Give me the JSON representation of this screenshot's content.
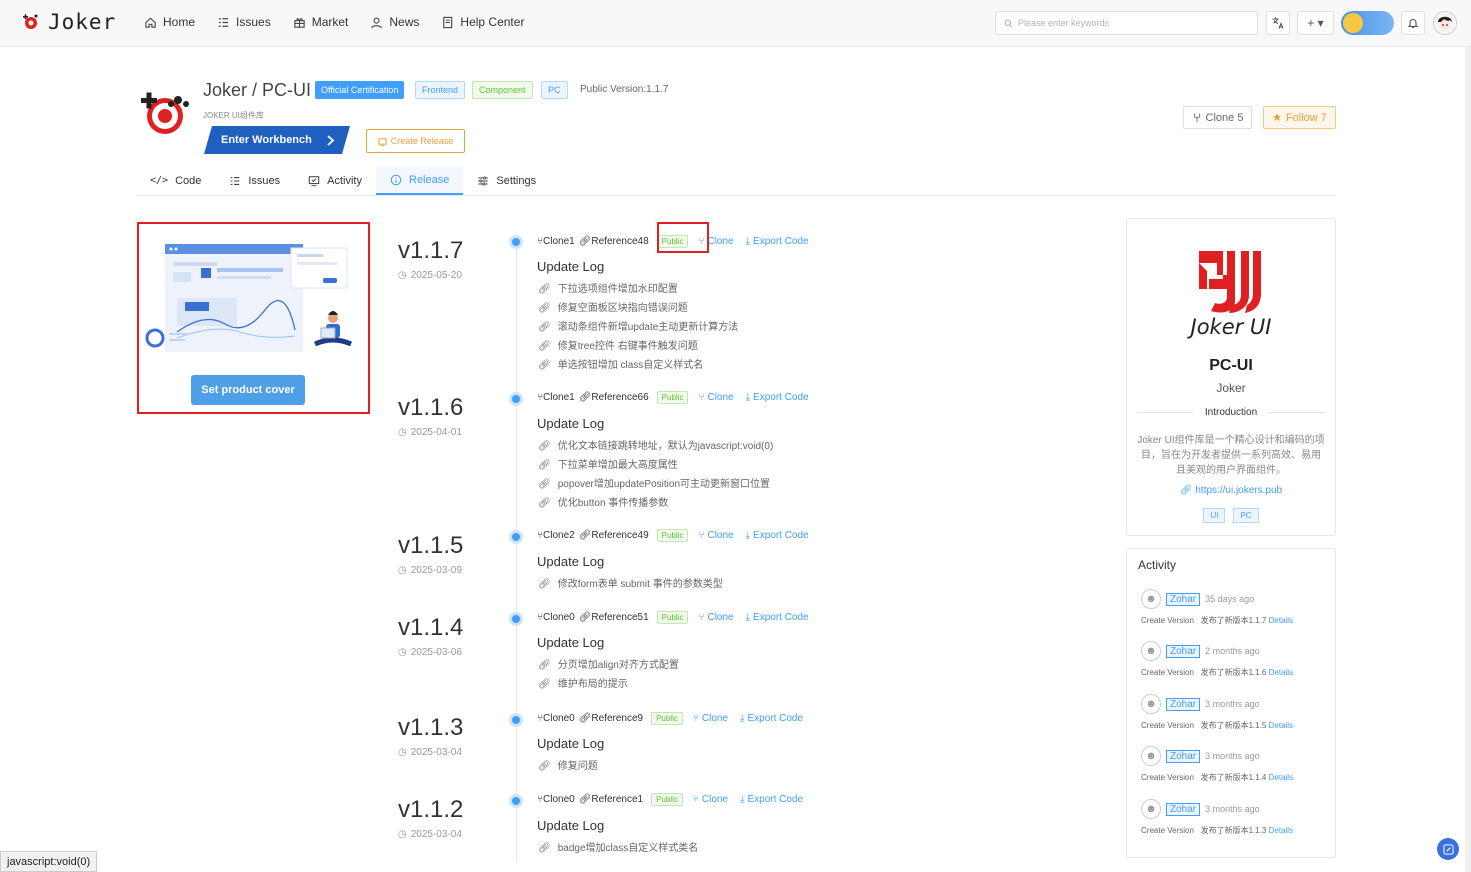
{
  "app": {
    "name": "Joker"
  },
  "nav": [
    {
      "label": "Home",
      "icon": "home-icon"
    },
    {
      "label": "Issues",
      "icon": "list-icon"
    },
    {
      "label": "Market",
      "icon": "gift-icon"
    },
    {
      "label": "News",
      "icon": "user-icon"
    },
    {
      "label": "Help Center",
      "icon": "book-icon"
    }
  ],
  "search": {
    "placeholder": "Please enter keywords"
  },
  "header_tools": {
    "plus": "+ ▾"
  },
  "repo": {
    "title": "Joker / PC-UI",
    "tags": [
      "Official Certification",
      "Frontend",
      "Component",
      "PC"
    ],
    "public_version": "Public Version:1.1.7",
    "subtitle": "JOKER UI组件库",
    "workbench": "Enter Workbench",
    "create_release": "Create Release",
    "clone": "Clone 5",
    "follow": "Follow 7"
  },
  "tabs": [
    "Code",
    "Issues",
    "Activity",
    "Release",
    "Settings"
  ],
  "active_tab": "Release",
  "cover": {
    "button": "Set product cover"
  },
  "release_labels": {
    "update_log": "Update Log",
    "public": "Public",
    "clone": "Clone",
    "export": "Export Code"
  },
  "releases": [
    {
      "version": "v1.1.7",
      "date": "2025-05-20",
      "clone": "Clone1",
      "ref": "Reference48",
      "items": [
        "下拉选项组件增加水印配置",
        "修复空面板区块指向错误问题",
        "滚动条组件新增update主动更新计算方法",
        "修复tree控件 右键事件触发问题",
        "单选按钮增加 class自定义样式名"
      ]
    },
    {
      "version": "v1.1.6",
      "date": "2025-04-01",
      "clone": "Clone1",
      "ref": "Reference66",
      "items": [
        "优化文本链接跳转地址，默认为javascript:void(0)",
        "下拉菜单增加最大高度属性",
        "popover增加updatePosition可主动更新窗口位置",
        "优化button 事件传播参数"
      ]
    },
    {
      "version": "v1.1.5",
      "date": "2025-03-09",
      "clone": "Clone2",
      "ref": "Reference49",
      "items": [
        "修改form表单 submit 事件的参数类型"
      ]
    },
    {
      "version": "v1.1.4",
      "date": "2025-03-06",
      "clone": "Clone0",
      "ref": "Reference51",
      "items": [
        "分页增加align对齐方式配置",
        "维护布局的提示"
      ]
    },
    {
      "version": "v1.1.3",
      "date": "2025-03-04",
      "clone": "Clone0",
      "ref": "Reference9",
      "items": [
        "修复问题"
      ]
    },
    {
      "version": "v1.1.2",
      "date": "2025-03-04",
      "clone": "Clone0",
      "ref": "Reference1",
      "items": [
        "badge增加class自定义样式类名"
      ]
    }
  ],
  "card": {
    "logo_text": "Joker UI",
    "name": "PC-UI",
    "owner": "Joker",
    "intro_label": "Introduction",
    "intro": "Joker UI组件库是一个精心设计和编码的项目，旨在为开发者提供一系列高效、易用且美观的用户界面组件。",
    "link": "https://ui.jokers.pub",
    "tags": [
      "UI",
      "PC"
    ]
  },
  "activity": {
    "title": "Activity",
    "items": [
      {
        "user": "Zohar",
        "time": "35 days ago",
        "type": "Create Version",
        "desc": "发布了新版本1.1.7",
        "details": "Details"
      },
      {
        "user": "Zohar",
        "time": "2 months ago",
        "type": "Create Version",
        "desc": "发布了新版本1.1.6",
        "details": "Details"
      },
      {
        "user": "Zohar",
        "time": "3 months ago",
        "type": "Create Version",
        "desc": "发布了新版本1.1.5",
        "details": "Details"
      },
      {
        "user": "Zohar",
        "time": "3 months ago",
        "type": "Create Version",
        "desc": "发布了新版本1.1.4",
        "details": "Details"
      },
      {
        "user": "Zohar",
        "time": "3 months ago",
        "type": "Create Version",
        "desc": "发布了新版本1.1.3",
        "details": "Details"
      }
    ]
  },
  "statusbar": "javascript:void(0)",
  "colors": {
    "accent": "#409eff",
    "brand_red": "#e02020",
    "orange": "#e6a23c",
    "green": "#67c23a"
  }
}
